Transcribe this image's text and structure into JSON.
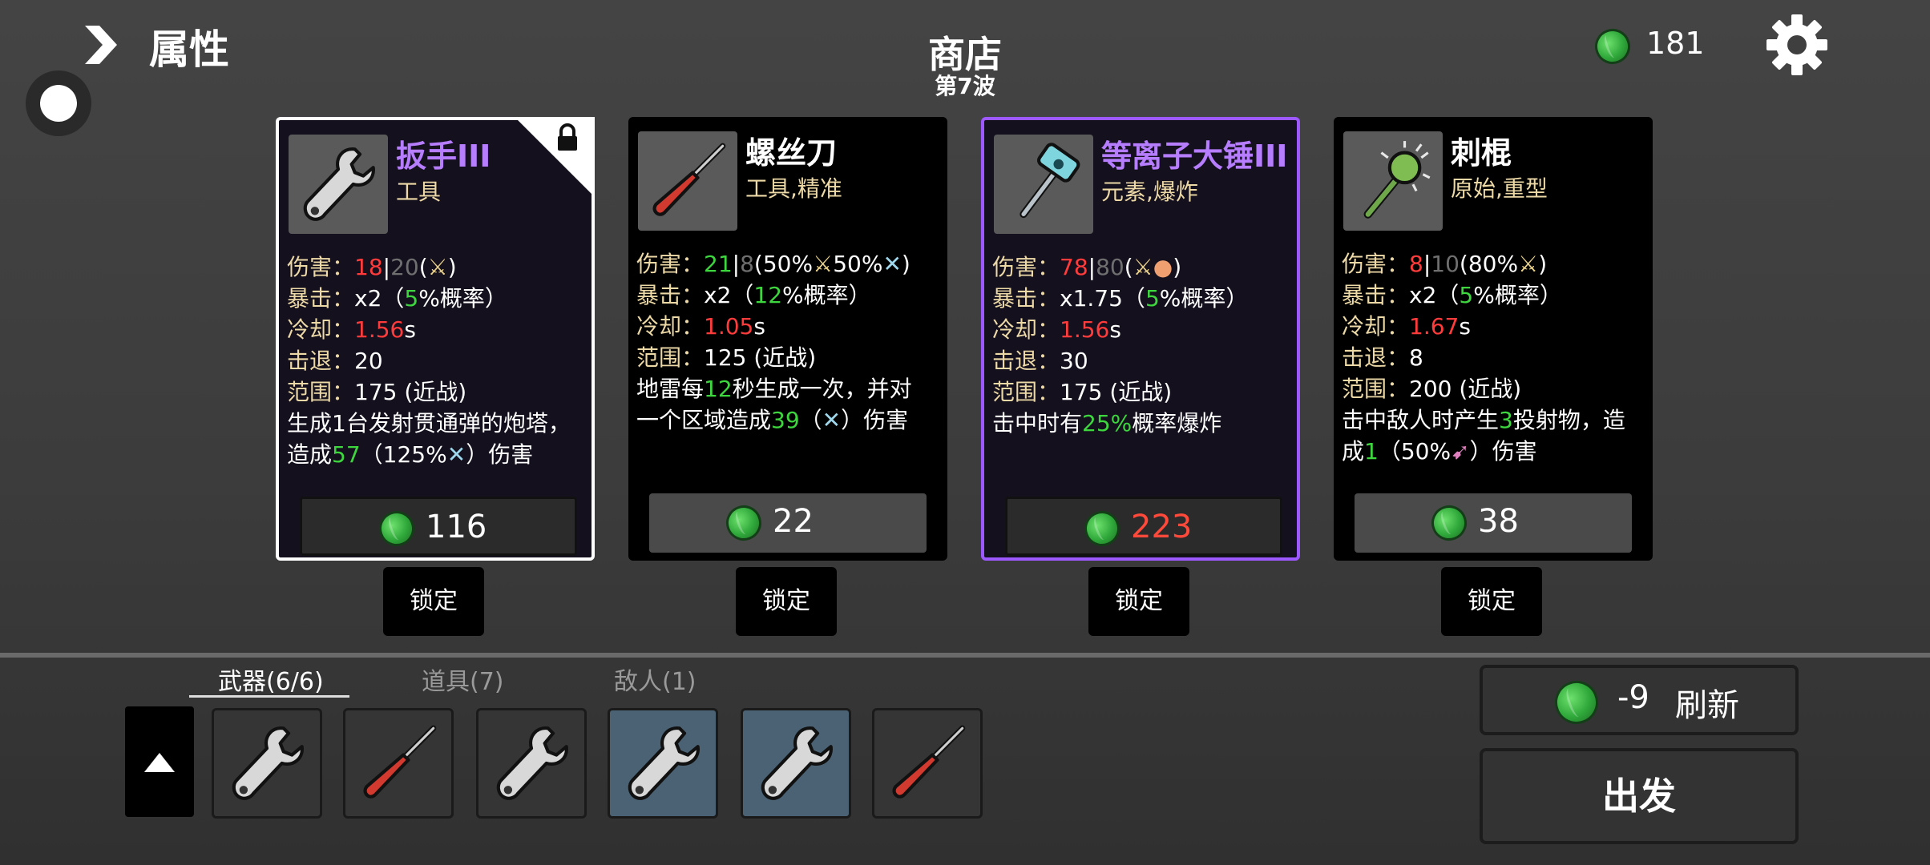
{
  "header": {
    "attributes_label": "属性",
    "shop_title": "商店",
    "wave_label": "第7波",
    "materials": "181"
  },
  "cards": [
    {
      "name": "扳手III",
      "name_color": "#b77dff",
      "tags": "工具",
      "locked": true,
      "icon": "wrench-icon",
      "stats": {
        "damage_label": "伤害：",
        "damage": "18",
        "damage_sep": "|",
        "damage_base": "20",
        "damage_scale": "(",
        "damage_end": ")",
        "crit_label": "暴击：",
        "crit_text": "x2（",
        "crit_chance": "5",
        "crit_end": "%概率）",
        "cooldown_label": "冷却：",
        "cooldown": "1.56",
        "cooldown_unit": "s",
        "knockback_label": "击退：",
        "knockback": "20",
        "range_label": "范围：",
        "range": "175 (近战)",
        "effect_1": "生成1台发射贯通弹的炮塔，",
        "effect_2a": "造成",
        "effect_2b": "57",
        "effect_2c": "（125%",
        "effect_2d": "）伤害"
      },
      "price": "116",
      "price_color": "#ffffff",
      "lock_label": "锁定"
    },
    {
      "name": "螺丝刀",
      "name_color": "#ffffff",
      "tags": "工具,精准",
      "locked": false,
      "icon": "screwdriver-icon",
      "stats": {
        "damage_label": "伤害：",
        "damage": "21",
        "damage_sep": "|",
        "damage_base": "8",
        "damage_scale": "(50%",
        "damage_mid": "50%",
        "damage_end": ")",
        "crit_label": "暴击：",
        "crit_text": "x2（",
        "crit_chance": "12",
        "crit_end": "%概率）",
        "cooldown_label": "冷却：",
        "cooldown": "1.05",
        "cooldown_unit": "s",
        "range_label": "范围：",
        "range": "125 (近战)",
        "effect_1a": "地雷每",
        "effect_1b": "12",
        "effect_1c": "秒生成一次，并对",
        "effect_2a": "一个区域造成",
        "effect_2b": "39",
        "effect_2c": "（",
        "effect_2d": "）伤害"
      },
      "price": "22",
      "price_color": "#ffffff",
      "lock_label": "锁定"
    },
    {
      "name": "等离子大锤III",
      "name_color": "#b77dff",
      "tags": "元素,爆炸",
      "locked": false,
      "icon": "plasma-hammer-icon",
      "stats": {
        "damage_label": "伤害：",
        "damage": "78",
        "damage_sep": "|",
        "damage_base": "80",
        "damage_scale": "(",
        "damage_end": ")",
        "crit_label": "暴击：",
        "crit_text": "x1.75（",
        "crit_chance": "5",
        "crit_end": "%概率）",
        "cooldown_label": "冷却：",
        "cooldown": "1.56",
        "cooldown_unit": "s",
        "knockback_label": "击退：",
        "knockback": "30",
        "range_label": "范围：",
        "range": "175 (近战)",
        "effect_1a": "击中时有",
        "effect_1b": "25%",
        "effect_1c": "概率爆炸"
      },
      "price": "223",
      "price_color": "#ff4a3b",
      "lock_label": "锁定"
    },
    {
      "name": "刺棍",
      "name_color": "#ffffff",
      "tags": "原始,重型",
      "locked": false,
      "icon": "spiked-club-icon",
      "stats": {
        "damage_label": "伤害：",
        "damage": "8",
        "damage_sep": "|",
        "damage_base": "10",
        "damage_scale": "(80%",
        "damage_end": ")",
        "crit_label": "暴击：",
        "crit_text": "x2（",
        "crit_chance": "5",
        "crit_end": "%概率）",
        "cooldown_label": "冷却：",
        "cooldown": "1.67",
        "cooldown_unit": "s",
        "knockback_label": "击退：",
        "knockback": "8",
        "range_label": "范围：",
        "range": "200 (近战)",
        "effect_1a": "击中敌人时产生",
        "effect_1b": "3",
        "effect_1c": "投射物，造",
        "effect_2a": "成",
        "effect_2b": "1",
        "effect_2c": "（50%",
        "effect_2d": "）伤害"
      },
      "price": "38",
      "price_color": "#ffffff",
      "lock_label": "锁定"
    }
  ],
  "inventory": {
    "tabs": [
      {
        "label": "武器(6/6)"
      },
      {
        "label": "道具(7)"
      },
      {
        "label": "敌人(1)"
      }
    ],
    "slots": [
      {
        "icon": "wrench-icon",
        "tier": "normal"
      },
      {
        "icon": "screwdriver-icon",
        "tier": "normal"
      },
      {
        "icon": "wrench-icon",
        "tier": "normal"
      },
      {
        "icon": "wrench-icon",
        "tier": "blue"
      },
      {
        "icon": "wrench-icon",
        "tier": "blue"
      },
      {
        "icon": "screwdriver-icon",
        "tier": "normal"
      }
    ]
  },
  "actions": {
    "refresh_cost": "-9",
    "refresh_label": "刷新",
    "go_label": "出发"
  },
  "colors": {
    "rare_purple": "#b77dff",
    "damage_red": "#ff3b3b",
    "bonus_green": "#3ed63e",
    "label_gold": "#ecd9a6",
    "unaffordable_red": "#ff4a3b"
  }
}
